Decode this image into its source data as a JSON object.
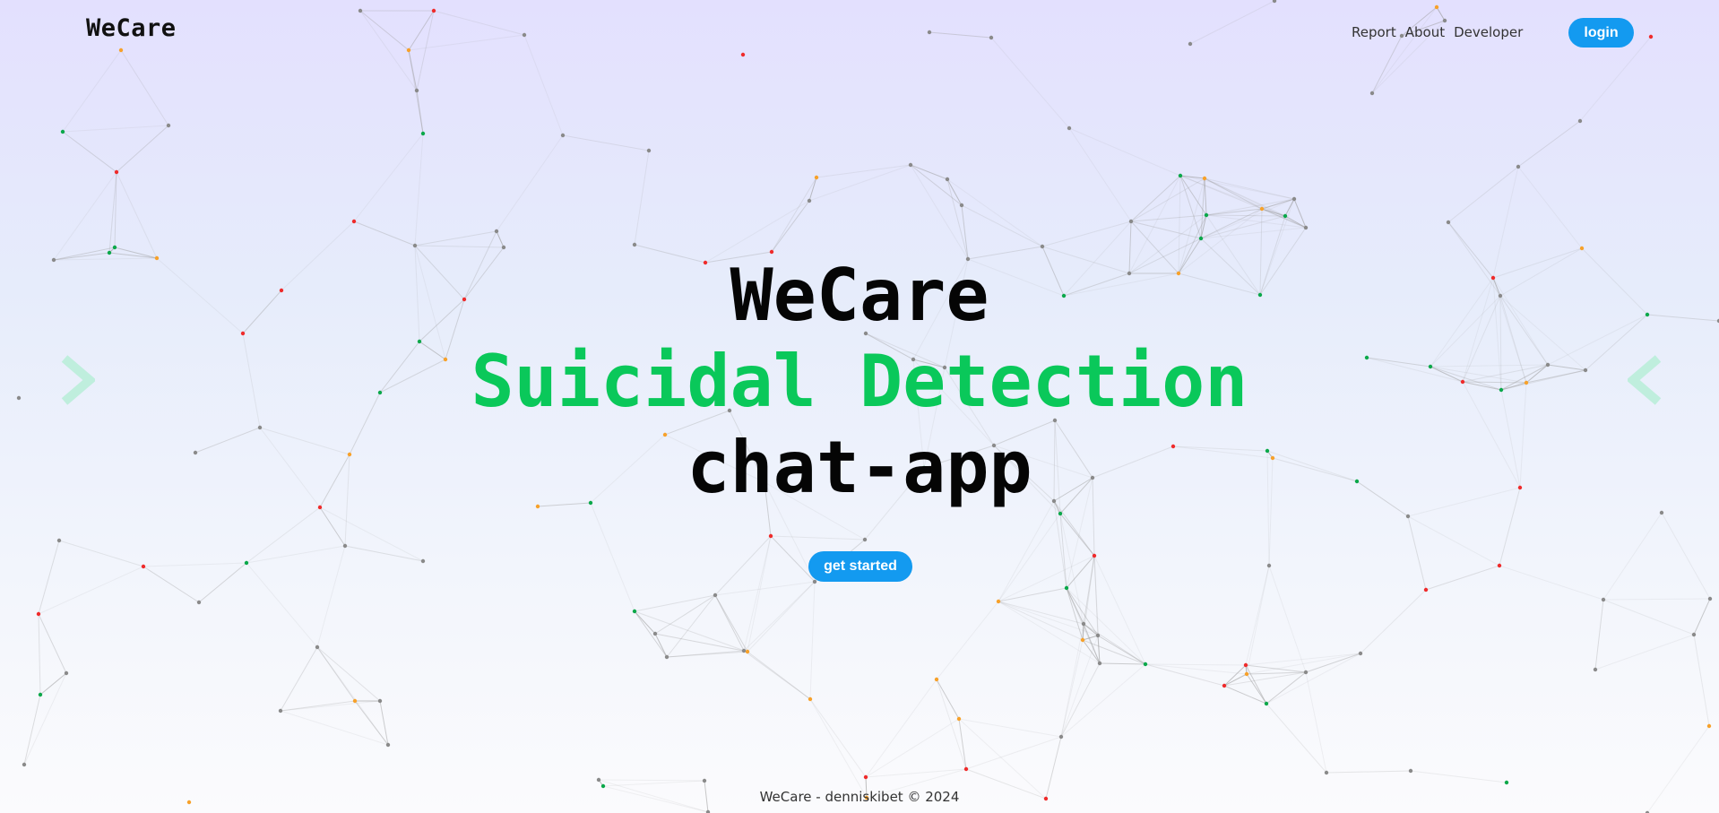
{
  "brand": {
    "name": "WeCare"
  },
  "nav": {
    "items": [
      {
        "label": "Report"
      },
      {
        "label": "About"
      },
      {
        "label": "Developer"
      }
    ],
    "login_label": "login"
  },
  "hero": {
    "line1": "WeCare",
    "line2": "Suicidal Detection",
    "line3": "chat-app",
    "cta_label": "get started"
  },
  "carousel": {
    "prev_icon": "chevron-right-icon",
    "next_icon": "chevron-left-icon"
  },
  "footer": {
    "text": "WeCare - denniskibet © 2024"
  },
  "colors": {
    "accent_green": "#0ac85a",
    "button_blue": "#139af0",
    "node_red": "#ef2b2b",
    "node_orange": "#f7a12a",
    "node_green": "#0aa84a",
    "node_gray": "#8a8a8a",
    "link_gray": "#9a9a9a"
  }
}
